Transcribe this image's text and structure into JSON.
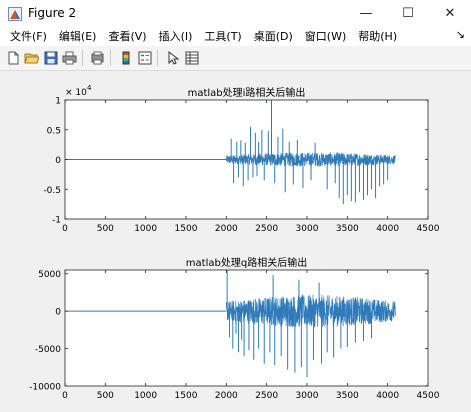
{
  "window": {
    "title": "Figure 2",
    "controls": {
      "minimize": "—",
      "maximize": "☐",
      "close": "✕"
    }
  },
  "menu": {
    "items": [
      "文件(F)",
      "编辑(E)",
      "查看(V)",
      "插入(I)",
      "工具(T)",
      "桌面(D)",
      "窗口(W)",
      "帮助(H)"
    ],
    "end_glyph": "↘"
  },
  "toolbar": {
    "icons": [
      "new-figure-icon",
      "open-file-icon",
      "save-icon",
      "print-icon",
      "print-preview-icon",
      "colorbar-icon",
      "legend-icon",
      "pointer-icon",
      "property-inspector-icon"
    ]
  },
  "colors": {
    "series": "#2f7ab9",
    "axes_bg": "#ffffff",
    "figure_bg": "#f0f0f0"
  },
  "chart_data": [
    {
      "type": "line",
      "title": "matlab处理i路相关后输出",
      "xlabel": "",
      "ylabel": "",
      "xlim": [
        0,
        4500
      ],
      "ylim": [
        -1,
        1
      ],
      "y_exponent_label": "× 10",
      "y_exponent_power": "4",
      "x_ticks": [
        "0",
        "500",
        "1000",
        "1500",
        "2000",
        "2500",
        "3000",
        "3500",
        "4000",
        "4500"
      ],
      "y_ticks": [
        "1",
        "0.5",
        "0",
        "-0.5",
        "-1"
      ],
      "y_tick_values": [
        1,
        0.5,
        0,
        -0.5,
        -1
      ],
      "series": [
        {
          "description": "flat zero from 0 to ~2000, then dense noise-like signal from 2000 to ~4096 with spikes",
          "segments": [
            {
              "x": [
                0,
                2000
              ],
              "y": [
                0,
                0
              ]
            }
          ],
          "noise_region": {
            "x": [
              2000,
              4096
            ],
            "amp": 0.12
          },
          "spikes": [
            {
              "x": 2060,
              "y": 0.35
            },
            {
              "x": 2090,
              "y": -0.4
            },
            {
              "x": 2130,
              "y": 0.3
            },
            {
              "x": 2150,
              "y": -0.3
            },
            {
              "x": 2180,
              "y": 0.32
            },
            {
              "x": 2210,
              "y": -0.45
            },
            {
              "x": 2235,
              "y": 0.28
            },
            {
              "x": 2270,
              "y": -0.35
            },
            {
              "x": 2300,
              "y": 0.55
            },
            {
              "x": 2330,
              "y": -0.3
            },
            {
              "x": 2360,
              "y": 0.45
            },
            {
              "x": 2380,
              "y": -0.28
            },
            {
              "x": 2400,
              "y": 0.3
            },
            {
              "x": 2440,
              "y": 0.5
            },
            {
              "x": 2470,
              "y": -0.35
            },
            {
              "x": 2520,
              "y": 0.48
            },
            {
              "x": 2560,
              "y": 1.0
            },
            {
              "x": 2600,
              "y": -0.4
            },
            {
              "x": 2640,
              "y": 0.38
            },
            {
              "x": 2700,
              "y": 0.52
            },
            {
              "x": 2730,
              "y": -0.55
            },
            {
              "x": 2780,
              "y": 0.3
            },
            {
              "x": 2830,
              "y": -0.42
            },
            {
              "x": 2880,
              "y": 0.33
            },
            {
              "x": 2950,
              "y": -0.48
            },
            {
              "x": 3050,
              "y": -0.35
            },
            {
              "x": 3100,
              "y": 0.28
            },
            {
              "x": 3250,
              "y": -0.5
            },
            {
              "x": 3350,
              "y": -0.4
            },
            {
              "x": 3400,
              "y": -0.65
            },
            {
              "x": 3450,
              "y": -0.75
            },
            {
              "x": 3500,
              "y": -0.6
            },
            {
              "x": 3550,
              "y": -0.7
            },
            {
              "x": 3600,
              "y": -0.72
            },
            {
              "x": 3650,
              "y": -0.55
            },
            {
              "x": 3700,
              "y": -0.68
            },
            {
              "x": 3750,
              "y": -0.6
            },
            {
              "x": 3800,
              "y": -0.5
            },
            {
              "x": 3850,
              "y": -0.65
            },
            {
              "x": 3900,
              "y": -0.45
            },
            {
              "x": 3950,
              "y": -0.42
            },
            {
              "x": 4000,
              "y": -0.35
            }
          ]
        }
      ]
    },
    {
      "type": "line",
      "title": "matlab处理q路相关后输出",
      "xlabel": "",
      "ylabel": "",
      "xlim": [
        0,
        4500
      ],
      "ylim": [
        -10000,
        5500
      ],
      "x_ticks": [
        "0",
        "500",
        "1000",
        "1500",
        "2000",
        "2500",
        "3000",
        "3500",
        "4000",
        "4500"
      ],
      "y_ticks": [
        "5000",
        "0",
        "-5000",
        "-10000"
      ],
      "y_tick_values": [
        5000,
        0,
        -5000,
        -10000
      ],
      "series": [
        {
          "description": "flat zero from 0 to ~2000, then dense noise-like signal from 2000 to ~4096 with spikes",
          "segments": [
            {
              "x": [
                0,
                2000
              ],
              "y": [
                0,
                0
              ]
            }
          ],
          "noise_region": {
            "x": [
              2000,
              4096
            ],
            "amp": 2200
          },
          "spikes": [
            {
              "x": 2010,
              "y": 5500
            },
            {
              "x": 2040,
              "y": -3500
            },
            {
              "x": 2080,
              "y": -5000
            },
            {
              "x": 2120,
              "y": -3000
            },
            {
              "x": 2150,
              "y": -5500
            },
            {
              "x": 2190,
              "y": -3800
            },
            {
              "x": 2220,
              "y": -6000
            },
            {
              "x": 2280,
              "y": -5200
            },
            {
              "x": 2340,
              "y": -6500
            },
            {
              "x": 2400,
              "y": -5000
            },
            {
              "x": 2470,
              "y": -7000
            },
            {
              "x": 2540,
              "y": -5500
            },
            {
              "x": 2600,
              "y": -7200
            },
            {
              "x": 2680,
              "y": -6000
            },
            {
              "x": 2760,
              "y": -7800
            },
            {
              "x": 2850,
              "y": -8200
            },
            {
              "x": 2930,
              "y": -7500
            },
            {
              "x": 3000,
              "y": -8800
            },
            {
              "x": 3080,
              "y": -6500
            },
            {
              "x": 3180,
              "y": -7000
            },
            {
              "x": 3250,
              "y": -5500
            },
            {
              "x": 3330,
              "y": -6200
            },
            {
              "x": 3420,
              "y": -5000
            },
            {
              "x": 3500,
              "y": -4800
            },
            {
              "x": 3600,
              "y": -4200
            },
            {
              "x": 3700,
              "y": -4000
            },
            {
              "x": 3800,
              "y": -3600
            },
            {
              "x": 2580,
              "y": 4800
            },
            {
              "x": 2900,
              "y": 4200
            },
            {
              "x": 3150,
              "y": 3800
            }
          ]
        }
      ]
    }
  ]
}
